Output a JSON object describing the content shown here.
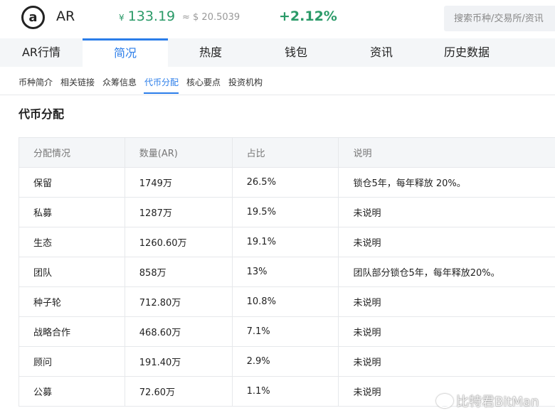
{
  "header": {
    "logo_letter": "a",
    "coin": "AR",
    "cny_symbol": "¥",
    "cny_price": "133.19",
    "usd_price": "≈ $ 20.5039",
    "change": "+2.12%",
    "search_placeholder": "搜索币种/交易所/资讯"
  },
  "tabs": [
    {
      "label": "AR行情"
    },
    {
      "label": "简况",
      "active": true
    },
    {
      "label": "热度"
    },
    {
      "label": "钱包"
    },
    {
      "label": "资讯"
    },
    {
      "label": "历史数据"
    }
  ],
  "subnav": [
    {
      "label": "币种简介"
    },
    {
      "label": "相关链接"
    },
    {
      "label": "众筹信息"
    },
    {
      "label": "代币分配",
      "active": true
    },
    {
      "label": "核心要点"
    },
    {
      "label": "投资机构"
    }
  ],
  "section_title": "代币分配",
  "table": {
    "headers": [
      "分配情况",
      "数量(AR)",
      "占比",
      "说明"
    ],
    "rows": [
      [
        "保留",
        "1749万",
        "26.5%",
        "锁仓5年，每年释放 20%。"
      ],
      [
        "私募",
        "1287万",
        "19.5%",
        "未说明"
      ],
      [
        "生态",
        "1260.60万",
        "19.1%",
        "未说明"
      ],
      [
        "团队",
        "858万",
        "13%",
        "团队部分锁仓5年，每年释放20%。"
      ],
      [
        "种子轮",
        "712.80万",
        "10.8%",
        "未说明"
      ],
      [
        "战略合作",
        "468.60万",
        "7.1%",
        "未说明"
      ],
      [
        "顾问",
        "191.40万",
        "2.9%",
        "未说明"
      ],
      [
        "公募",
        "72.60万",
        "1.1%",
        "未说明"
      ]
    ]
  },
  "watermark": "比特君BitMan",
  "colors": {
    "accent": "#2b7de9",
    "up": "#2a9a68"
  }
}
